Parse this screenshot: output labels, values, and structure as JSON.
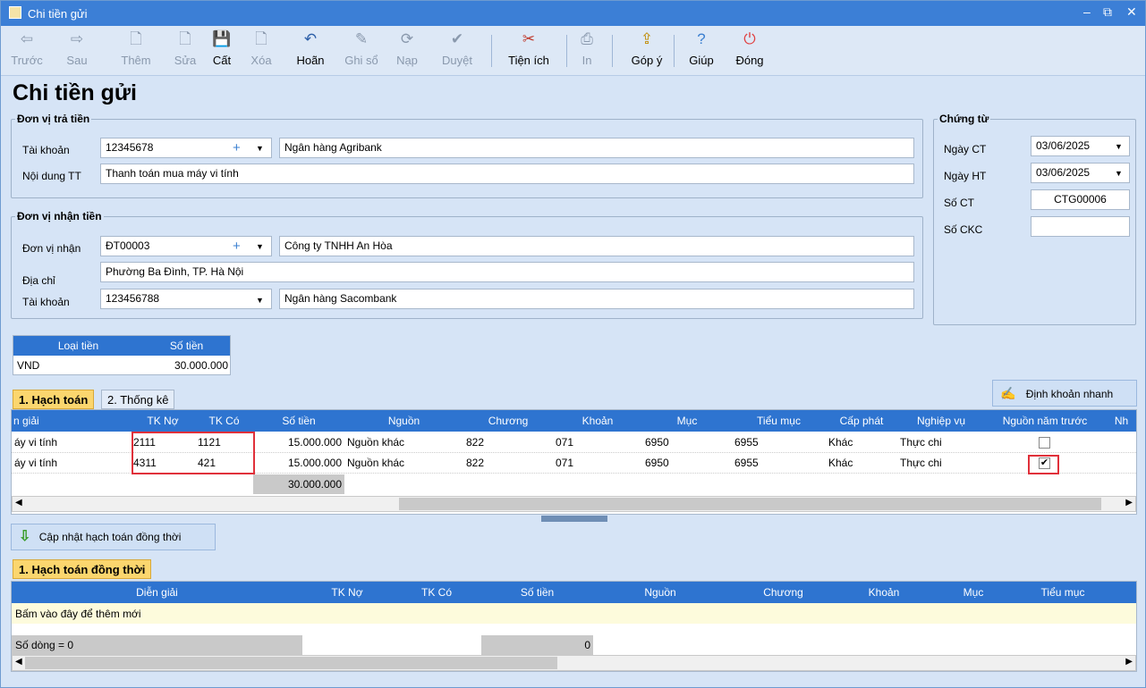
{
  "window": {
    "title": "Chi tiền gửi",
    "controls": [
      "–",
      "⧉",
      "✕"
    ]
  },
  "toolbar": [
    {
      "label": "Trước",
      "icon": "arrow-left-icon",
      "glyph": "⇦",
      "enabled": false
    },
    {
      "label": "Sau",
      "icon": "arrow-right-icon",
      "glyph": "⇨",
      "enabled": false
    },
    {
      "label": "Thêm",
      "icon": "add-document-icon",
      "glyph": "🗋",
      "enabled": false
    },
    {
      "label": "Sửa",
      "icon": "edit-document-icon",
      "glyph": "🗋",
      "enabled": false
    },
    {
      "label": "Cất",
      "icon": "save-icon",
      "glyph": "💾",
      "enabled": true
    },
    {
      "label": "Xóa",
      "icon": "delete-document-icon",
      "glyph": "🗋",
      "enabled": false
    },
    {
      "label": "Hoãn",
      "icon": "undo-icon",
      "glyph": "↶",
      "enabled": true
    },
    {
      "label": "Ghi sổ",
      "icon": "pencil-icon",
      "glyph": "✎",
      "enabled": false
    },
    {
      "label": "Nạp",
      "icon": "refresh-icon",
      "glyph": "⟳",
      "enabled": false
    },
    {
      "label": "Duyệt",
      "icon": "check-icon",
      "glyph": "✔",
      "enabled": false
    },
    {
      "label": "Tiện ích",
      "icon": "tools-icon",
      "glyph": "✂",
      "enabled": true
    },
    {
      "label": "In",
      "icon": "printer-icon",
      "glyph": "⎙",
      "enabled": false
    },
    {
      "label": "Góp ý",
      "icon": "feedback-icon",
      "glyph": "⇪",
      "enabled": true
    },
    {
      "label": "Giúp",
      "icon": "help-icon",
      "glyph": "?",
      "enabled": true
    },
    {
      "label": "Đóng",
      "icon": "power-icon",
      "glyph": "⏻",
      "enabled": true
    }
  ],
  "page_title": "Chi tiền gửi",
  "payer": {
    "legend": "Đơn vị trả tiền",
    "account_label": "Tài khoản",
    "account_value": "12345678",
    "bank_name": "Ngân hàng Agribank",
    "content_label": "Nội dung TT",
    "content_value": "Thanh toán mua máy vi tính"
  },
  "receiver": {
    "legend": "Đơn vị nhận tiền",
    "unit_label": "Đơn vị nhận",
    "unit_code": "ĐT00003",
    "unit_name": "Công ty TNHH An Hòa",
    "address_label": "Địa chỉ",
    "address_value": "Phường Ba Đình, TP. Hà Nội",
    "account_label": "Tài khoản",
    "account_value": "123456788",
    "bank_name": "Ngân hàng Sacombank"
  },
  "voucher": {
    "legend": "Chứng từ",
    "date_ct_label": "Ngày CT",
    "date_ct": "03/06/2025",
    "date_ht_label": "Ngày HT",
    "date_ht": "03/06/2025",
    "so_ct_label": "Số CT",
    "so_ct": "CTG00006",
    "so_ckc_label": "Số CKC",
    "so_ckc": ""
  },
  "currency": {
    "headers": [
      "Loại tiền",
      "Số tiền"
    ],
    "type": "VND",
    "amount": "30.000.000"
  },
  "tabs": {
    "hach_toan": "1. Hạch toán",
    "thong_ke": "2. Thống kê"
  },
  "quick_entry": "Định khoản nhanh",
  "main_grid": {
    "headers": [
      "n giải",
      "TK Nợ",
      "TK Có",
      "Số tiền",
      "Nguồn",
      "Chương",
      "Khoản",
      "Mục",
      "Tiểu mục",
      "Cấp phát",
      "Nghiệp vụ",
      "Nguồn năm trước",
      "Nh"
    ],
    "rows": [
      {
        "desc": "áy vi tính",
        "tk_no": "2111",
        "tk_co": "1121",
        "amount": "15.000.000",
        "nguon": "Nguồn khác",
        "chuong": "822",
        "khoan": "071",
        "muc": "6950",
        "tieu_muc": "6955",
        "cap_phat": "Khác",
        "nghiep_vu": "Thực chi",
        "nguon_nam_truoc": false
      },
      {
        "desc": "áy vi tính",
        "tk_no": "4311",
        "tk_co": "421",
        "amount": "15.000.000",
        "nguon": "Nguồn khác",
        "chuong": "822",
        "khoan": "071",
        "muc": "6950",
        "tieu_muc": "6955",
        "cap_phat": "Khác",
        "nghiep_vu": "Thực chi",
        "nguon_nam_truoc": true
      }
    ],
    "total": "30.000.000"
  },
  "update_button": "Cập nhật hạch toán đồng thời",
  "sub_tab": "1. Hạch toán đồng thời",
  "sub_grid": {
    "headers": [
      "Diễn giải",
      "TK Nợ",
      "TK Có",
      "Số tiền",
      "Nguồn",
      "Chương",
      "Khoản",
      "Mục",
      "Tiểu mục"
    ],
    "add_new": "Bấm vào đây để thêm mới",
    "row_count": "Số dòng = 0",
    "total": "0"
  }
}
